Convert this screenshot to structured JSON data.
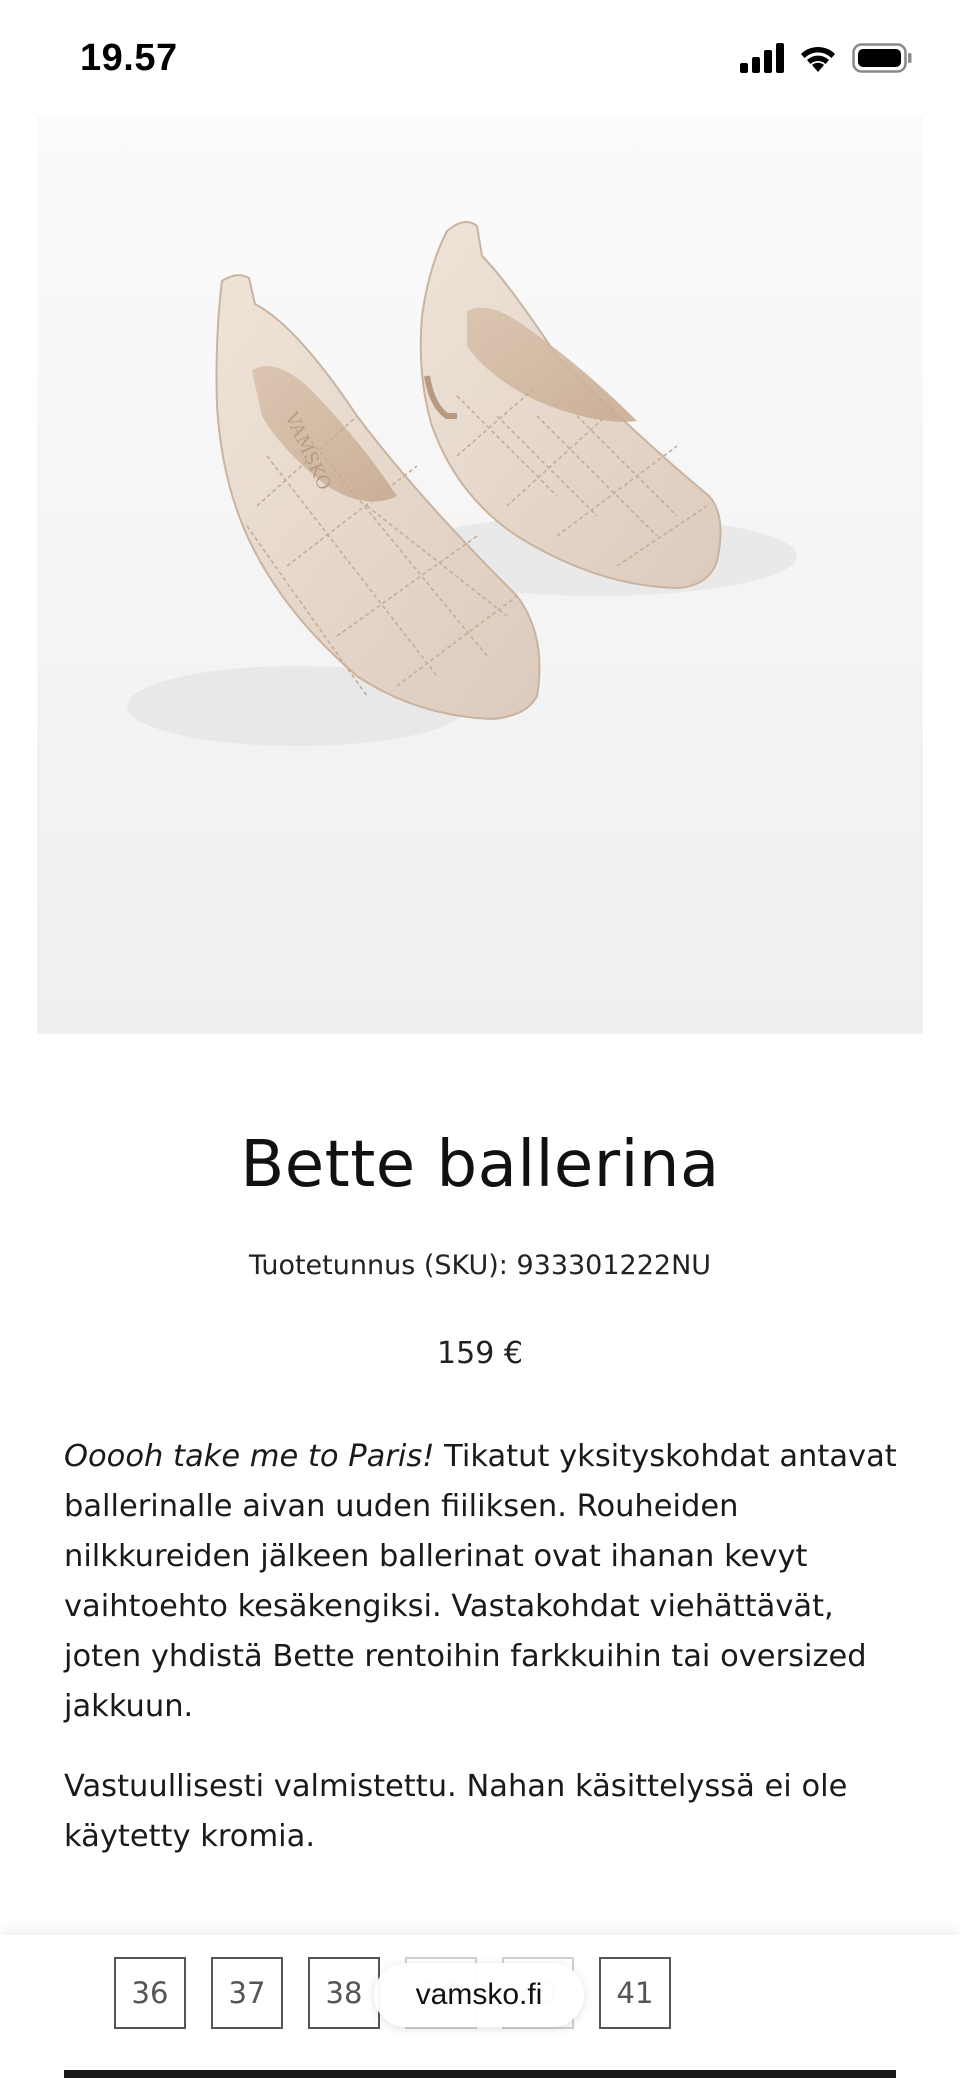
{
  "status_bar": {
    "time": "19.57",
    "icons": [
      "cellular-signal-icon",
      "wifi-icon",
      "battery-icon"
    ]
  },
  "product_image": {
    "alt": "Bette ballerina product photo",
    "carousel": {
      "count": 7,
      "active_index": 1
    }
  },
  "product": {
    "title": "Bette ballerina",
    "sku": "Tuotetunnus (SKU): 933301222NU",
    "price": "159 €",
    "description": {
      "italic_lead": "Ooooh take me to Paris!",
      "paragraph_1": " Tikatut yksityskohdat antavat ballerinalle aivan uuden fiiliksen. Rouheiden nilkkureiden jälkeen ballerinat ovat ihanan kevyt vaihtoehto kesäkengiksi. Vastakohdat viehättävät, joten yhdistä Bette rentoihin farkkuihin tai oversized jakkuun.",
      "paragraph_2": "Vastuullisesti valmistettu. Nahan käsittelyssä ei ole käytetty kromia."
    }
  },
  "sizes": {
    "options": [
      "36",
      "37",
      "38",
      "39",
      "40",
      "41"
    ]
  },
  "browser": {
    "url": "vamsko.fi"
  },
  "colors": {
    "accent": "#111111",
    "image_background": "#f4f4f4",
    "shoe": "#e8d9cc"
  }
}
